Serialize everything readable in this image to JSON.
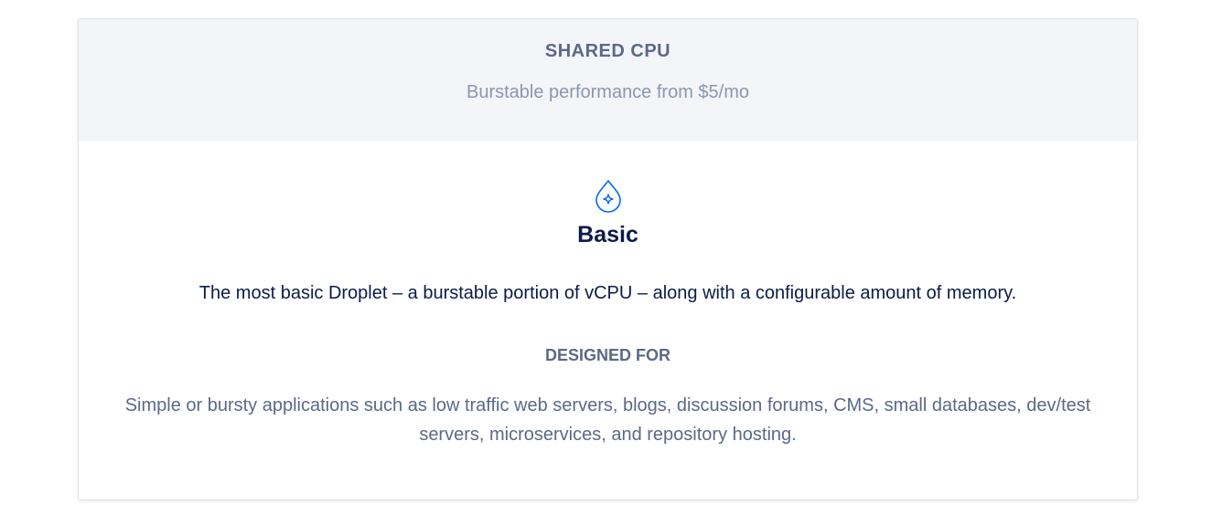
{
  "header": {
    "title": "SHARED CPU",
    "subtitle": "Burstable performance from $5/mo"
  },
  "plan": {
    "icon": "droplet-sparkle-icon",
    "name": "Basic",
    "description": "The most basic Droplet – a burstable portion of vCPU – along with a configurable amount of memory."
  },
  "designed_for": {
    "label": "DESIGNED FOR",
    "text": "Simple or bursty applications such as low traffic web servers, blogs, discussion forums, CMS, small databases, dev/test servers, microservices, and repository hosting."
  },
  "colors": {
    "accent": "#0069ff",
    "heading_dark": "#0c1b47",
    "muted": "#5b6987",
    "header_bg": "#f3f5f9"
  }
}
